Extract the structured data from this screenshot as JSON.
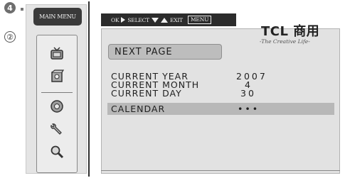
{
  "step_badge": "4",
  "step_circle": "②",
  "left_panel": {
    "title": "MAIN MENU",
    "icons": [
      "tv-icon",
      "settings-box-icon",
      "disc-icon",
      "wrench-icon",
      "magnifier-icon"
    ]
  },
  "top_bar": {
    "ok_label": "OK",
    "select_label": "SELECT",
    "exit_label": "EXIT",
    "menu_label": "MENU"
  },
  "logo": {
    "brand": "TCL 商用",
    "tagline": "-The Creative Life-"
  },
  "main": {
    "next_page": "NEXT PAGE",
    "rows": [
      {
        "label": "CURRENT YEAR",
        "value": "2007"
      },
      {
        "label": "CURRENT MONTH",
        "value": "4"
      },
      {
        "label": "CURRENT DAY",
        "value": "30"
      },
      {
        "label": "CALENDAR",
        "value": "•••"
      }
    ]
  }
}
